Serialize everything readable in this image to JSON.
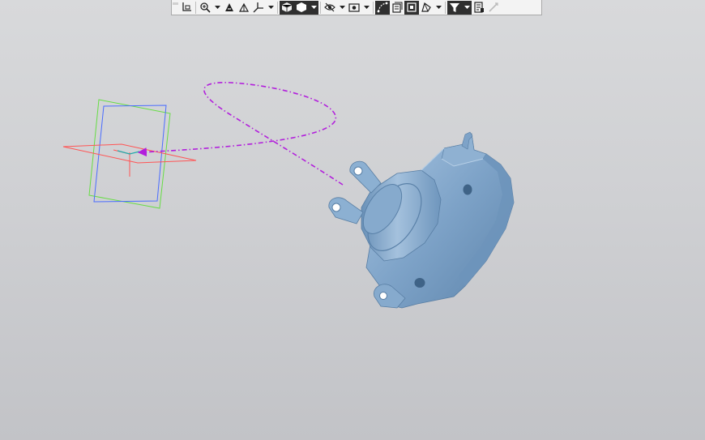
{
  "app": {
    "background_top": "#d8d9db",
    "background_bottom": "#c2c3c7"
  },
  "toolbar": {
    "groups": [
      {
        "icon": "grip-icon"
      },
      {
        "icon": "sketch-plane-icon"
      },
      {
        "icon": "zoom-icon",
        "dropdown": true
      },
      {
        "icon": "orient-icon"
      },
      {
        "icon": "normal-view-icon"
      },
      {
        "icon": "axis-triad-icon",
        "dropdown": true
      },
      {
        "icon": "wireframe-cube-icon",
        "active": true
      },
      {
        "icon": "shaded-cube-icon",
        "active": true,
        "dropdown": true
      },
      {
        "icon": "hide-eye-icon",
        "dropdown": true
      },
      {
        "icon": "display-mode-icon",
        "dropdown": true
      },
      {
        "icon": "curve-points-icon",
        "active": true
      },
      {
        "icon": "section-view-icon"
      },
      {
        "icon": "perspective-icon",
        "active": true
      },
      {
        "icon": "plane-view-icon",
        "dropdown": true
      },
      {
        "icon": "filter-icon",
        "active": true,
        "dropdown": true
      },
      {
        "icon": "properties-icon"
      },
      {
        "icon": "measure-disabled-icon",
        "disabled": true
      }
    ]
  },
  "scene": {
    "part_color": "#7ea3c8",
    "part_shadow": "#5d84ab",
    "part_highlight": "#a9c6e2",
    "trajectory_color": "#b21fdc",
    "plane_colors": {
      "x": "#ff5555",
      "y": "#66dd44",
      "z": "#4a6cff"
    }
  }
}
